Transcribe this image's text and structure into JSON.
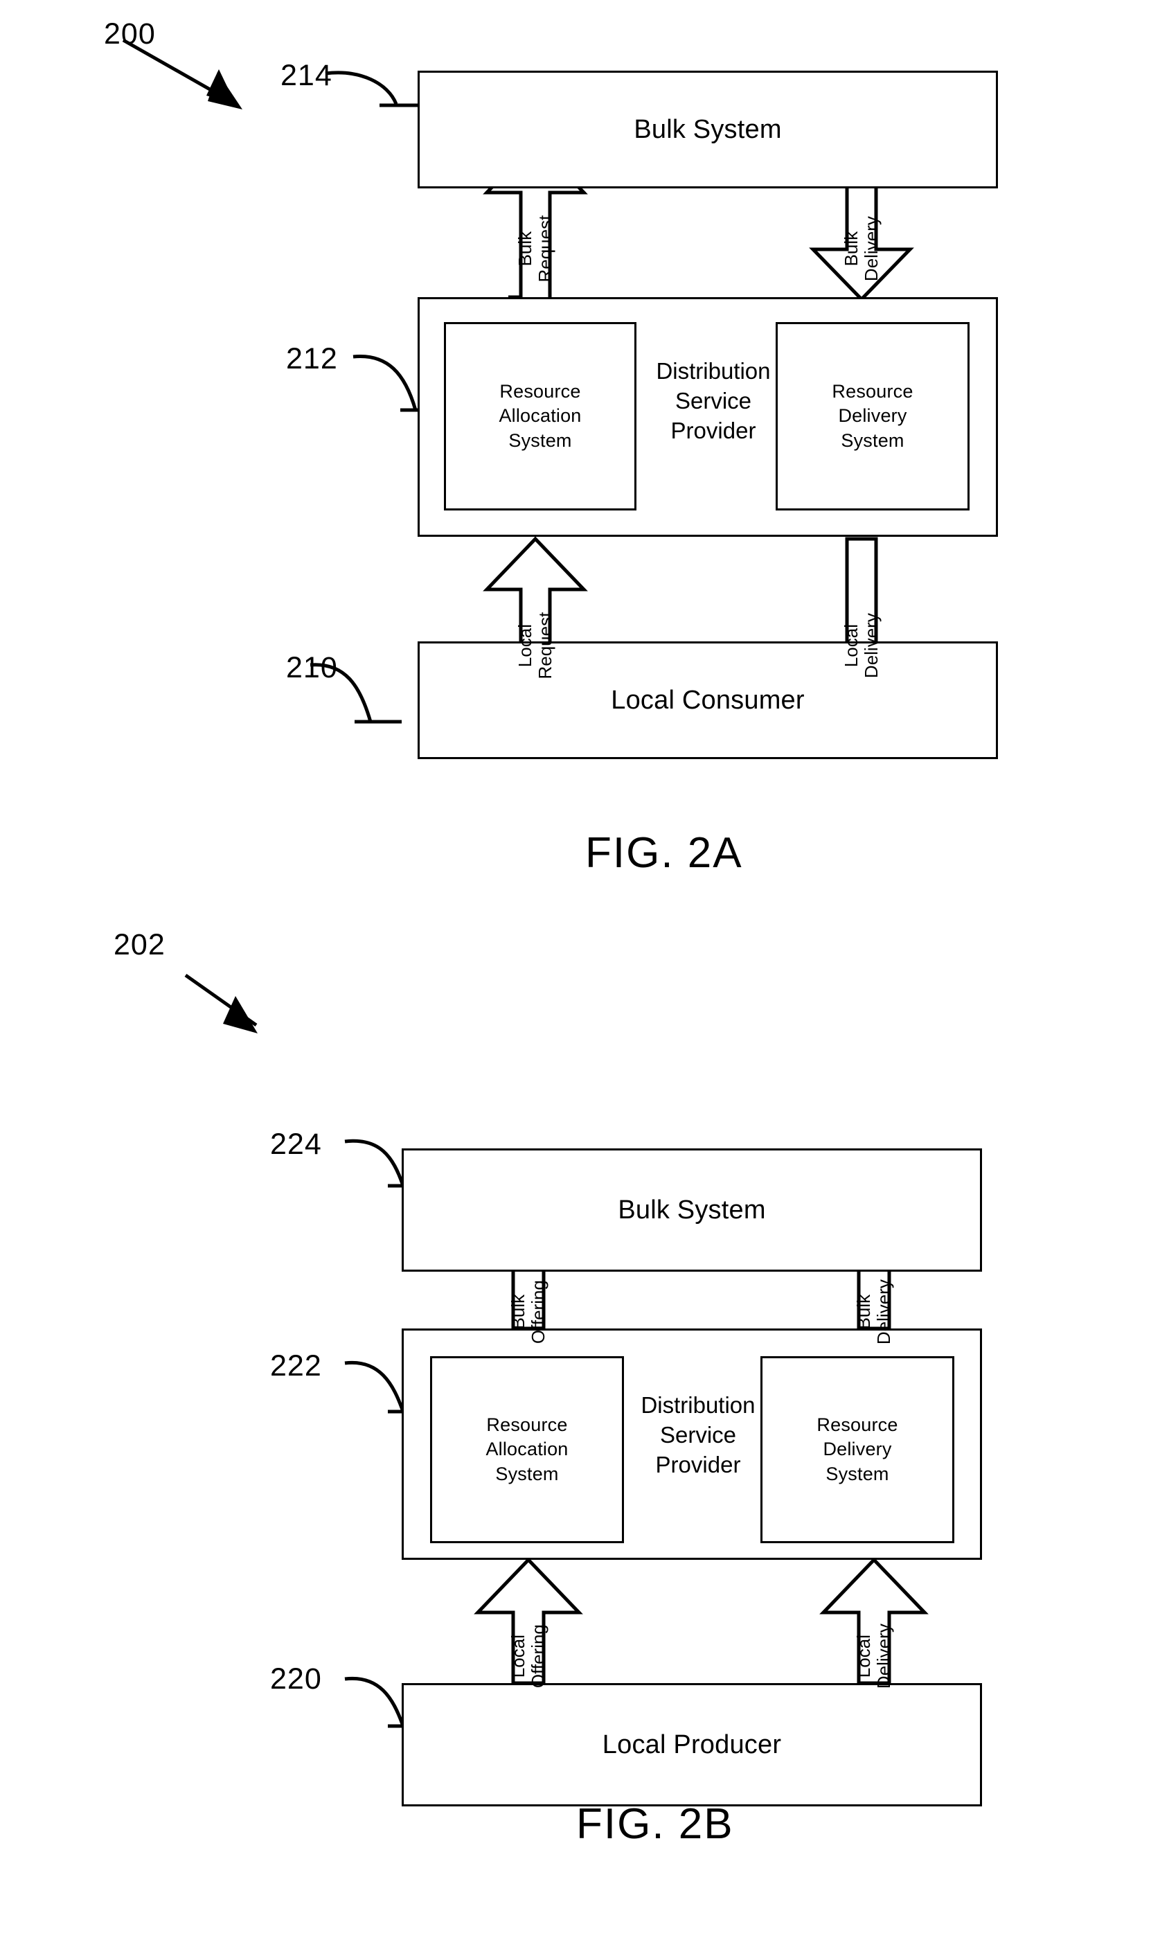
{
  "document": {
    "type": "patent-figure-sheet",
    "figures": [
      {
        "id": "fig2a",
        "caption": "FIG. 2A",
        "system_ref": "200",
        "nodes": [
          {
            "ref": "214",
            "label": "Bulk System"
          },
          {
            "ref": "212",
            "label": "Distribution Service Provider",
            "label_lines": [
              "Distribution",
              "Service",
              "Provider"
            ],
            "children": [
              {
                "label": "Resource Allocation System",
                "label_lines": [
                  "Resource",
                  "Allocation",
                  "System"
                ]
              },
              {
                "label": "Resource Delivery System",
                "label_lines": [
                  "Resource",
                  "Delivery",
                  "System"
                ]
              }
            ]
          },
          {
            "ref": "210",
            "label": "Local Consumer"
          }
        ],
        "flows": [
          {
            "label": "Bulk Request",
            "label_lines": [
              "Bulk",
              "Request"
            ],
            "direction": "up",
            "from": "212",
            "to": "214"
          },
          {
            "label": "Bulk Delivery",
            "label_lines": [
              "Bulk",
              "Delivery"
            ],
            "direction": "down",
            "from": "214",
            "to": "212"
          },
          {
            "label": "Local Request",
            "label_lines": [
              "Local",
              "Request"
            ],
            "direction": "up",
            "from": "210",
            "to": "212"
          },
          {
            "label": "Local Delivery",
            "label_lines": [
              "Local",
              "Delivery"
            ],
            "direction": "down",
            "from": "212",
            "to": "210"
          }
        ]
      },
      {
        "id": "fig2b",
        "caption": "FIG. 2B",
        "system_ref": "202",
        "nodes": [
          {
            "ref": "224",
            "label": "Bulk System"
          },
          {
            "ref": "222",
            "label": "Distribution Service Provider",
            "label_lines": [
              "Distribution",
              "Service",
              "Provider"
            ],
            "children": [
              {
                "label": "Resource Allocation System",
                "label_lines": [
                  "Resource",
                  "Allocation",
                  "System"
                ]
              },
              {
                "label": "Resource Delivery System",
                "label_lines": [
                  "Resource",
                  "Delivery",
                  "System"
                ]
              }
            ]
          },
          {
            "ref": "220",
            "label": "Local Producer"
          }
        ],
        "flows": [
          {
            "label": "Bulk Offering",
            "label_lines": [
              "Bulk",
              "Offering"
            ],
            "direction": "up",
            "from": "222",
            "to": "224"
          },
          {
            "label": "Bulk Delivery",
            "label_lines": [
              "Bulk",
              "Delivery"
            ],
            "direction": "up",
            "from": "222",
            "to": "224"
          },
          {
            "label": "Local Offering",
            "label_lines": [
              "Local",
              "Offering"
            ],
            "direction": "up",
            "from": "220",
            "to": "222"
          },
          {
            "label": "Local Delivery",
            "label_lines": [
              "Local",
              "Delivery"
            ],
            "direction": "up",
            "from": "220",
            "to": "222"
          }
        ]
      }
    ]
  },
  "fig2a": {
    "ref_system": "200",
    "caption": "FIG. 2A",
    "bulk": {
      "ref": "214",
      "label": "Bulk System"
    },
    "dsp": {
      "ref": "212",
      "line1": "Distribution",
      "line2": "Service",
      "line3": "Provider",
      "alloc": {
        "line1": "Resource",
        "line2": "Allocation",
        "line3": "System"
      },
      "delivery": {
        "line1": "Resource",
        "line2": "Delivery",
        "line3": "System"
      }
    },
    "local": {
      "ref": "210",
      "label": "Local Consumer"
    },
    "arrows": {
      "bulk_request": {
        "l1": "Bulk",
        "l2": "Request"
      },
      "bulk_delivery": {
        "l1": "Bulk",
        "l2": "Delivery"
      },
      "local_request": {
        "l1": "Local",
        "l2": "Request"
      },
      "local_delivery": {
        "l1": "Local",
        "l2": "Delivery"
      }
    }
  },
  "fig2b": {
    "ref_system": "202",
    "caption": "FIG. 2B",
    "bulk": {
      "ref": "224",
      "label": "Bulk System"
    },
    "dsp": {
      "ref": "222",
      "line1": "Distribution",
      "line2": "Service",
      "line3": "Provider",
      "alloc": {
        "line1": "Resource",
        "line2": "Allocation",
        "line3": "System"
      },
      "delivery": {
        "line1": "Resource",
        "line2": "Delivery",
        "line3": "System"
      }
    },
    "local": {
      "ref": "220",
      "label": "Local Producer"
    },
    "arrows": {
      "bulk_offering": {
        "l1": "Bulk",
        "l2": "Offering"
      },
      "bulk_delivery": {
        "l1": "Bulk",
        "l2": "Delivery"
      },
      "local_offering": {
        "l1": "Local",
        "l2": "Offering"
      },
      "local_delivery": {
        "l1": "Local",
        "l2": "Delivery"
      }
    }
  },
  "colors": {
    "ink": "#000000",
    "paper": "#ffffff"
  }
}
